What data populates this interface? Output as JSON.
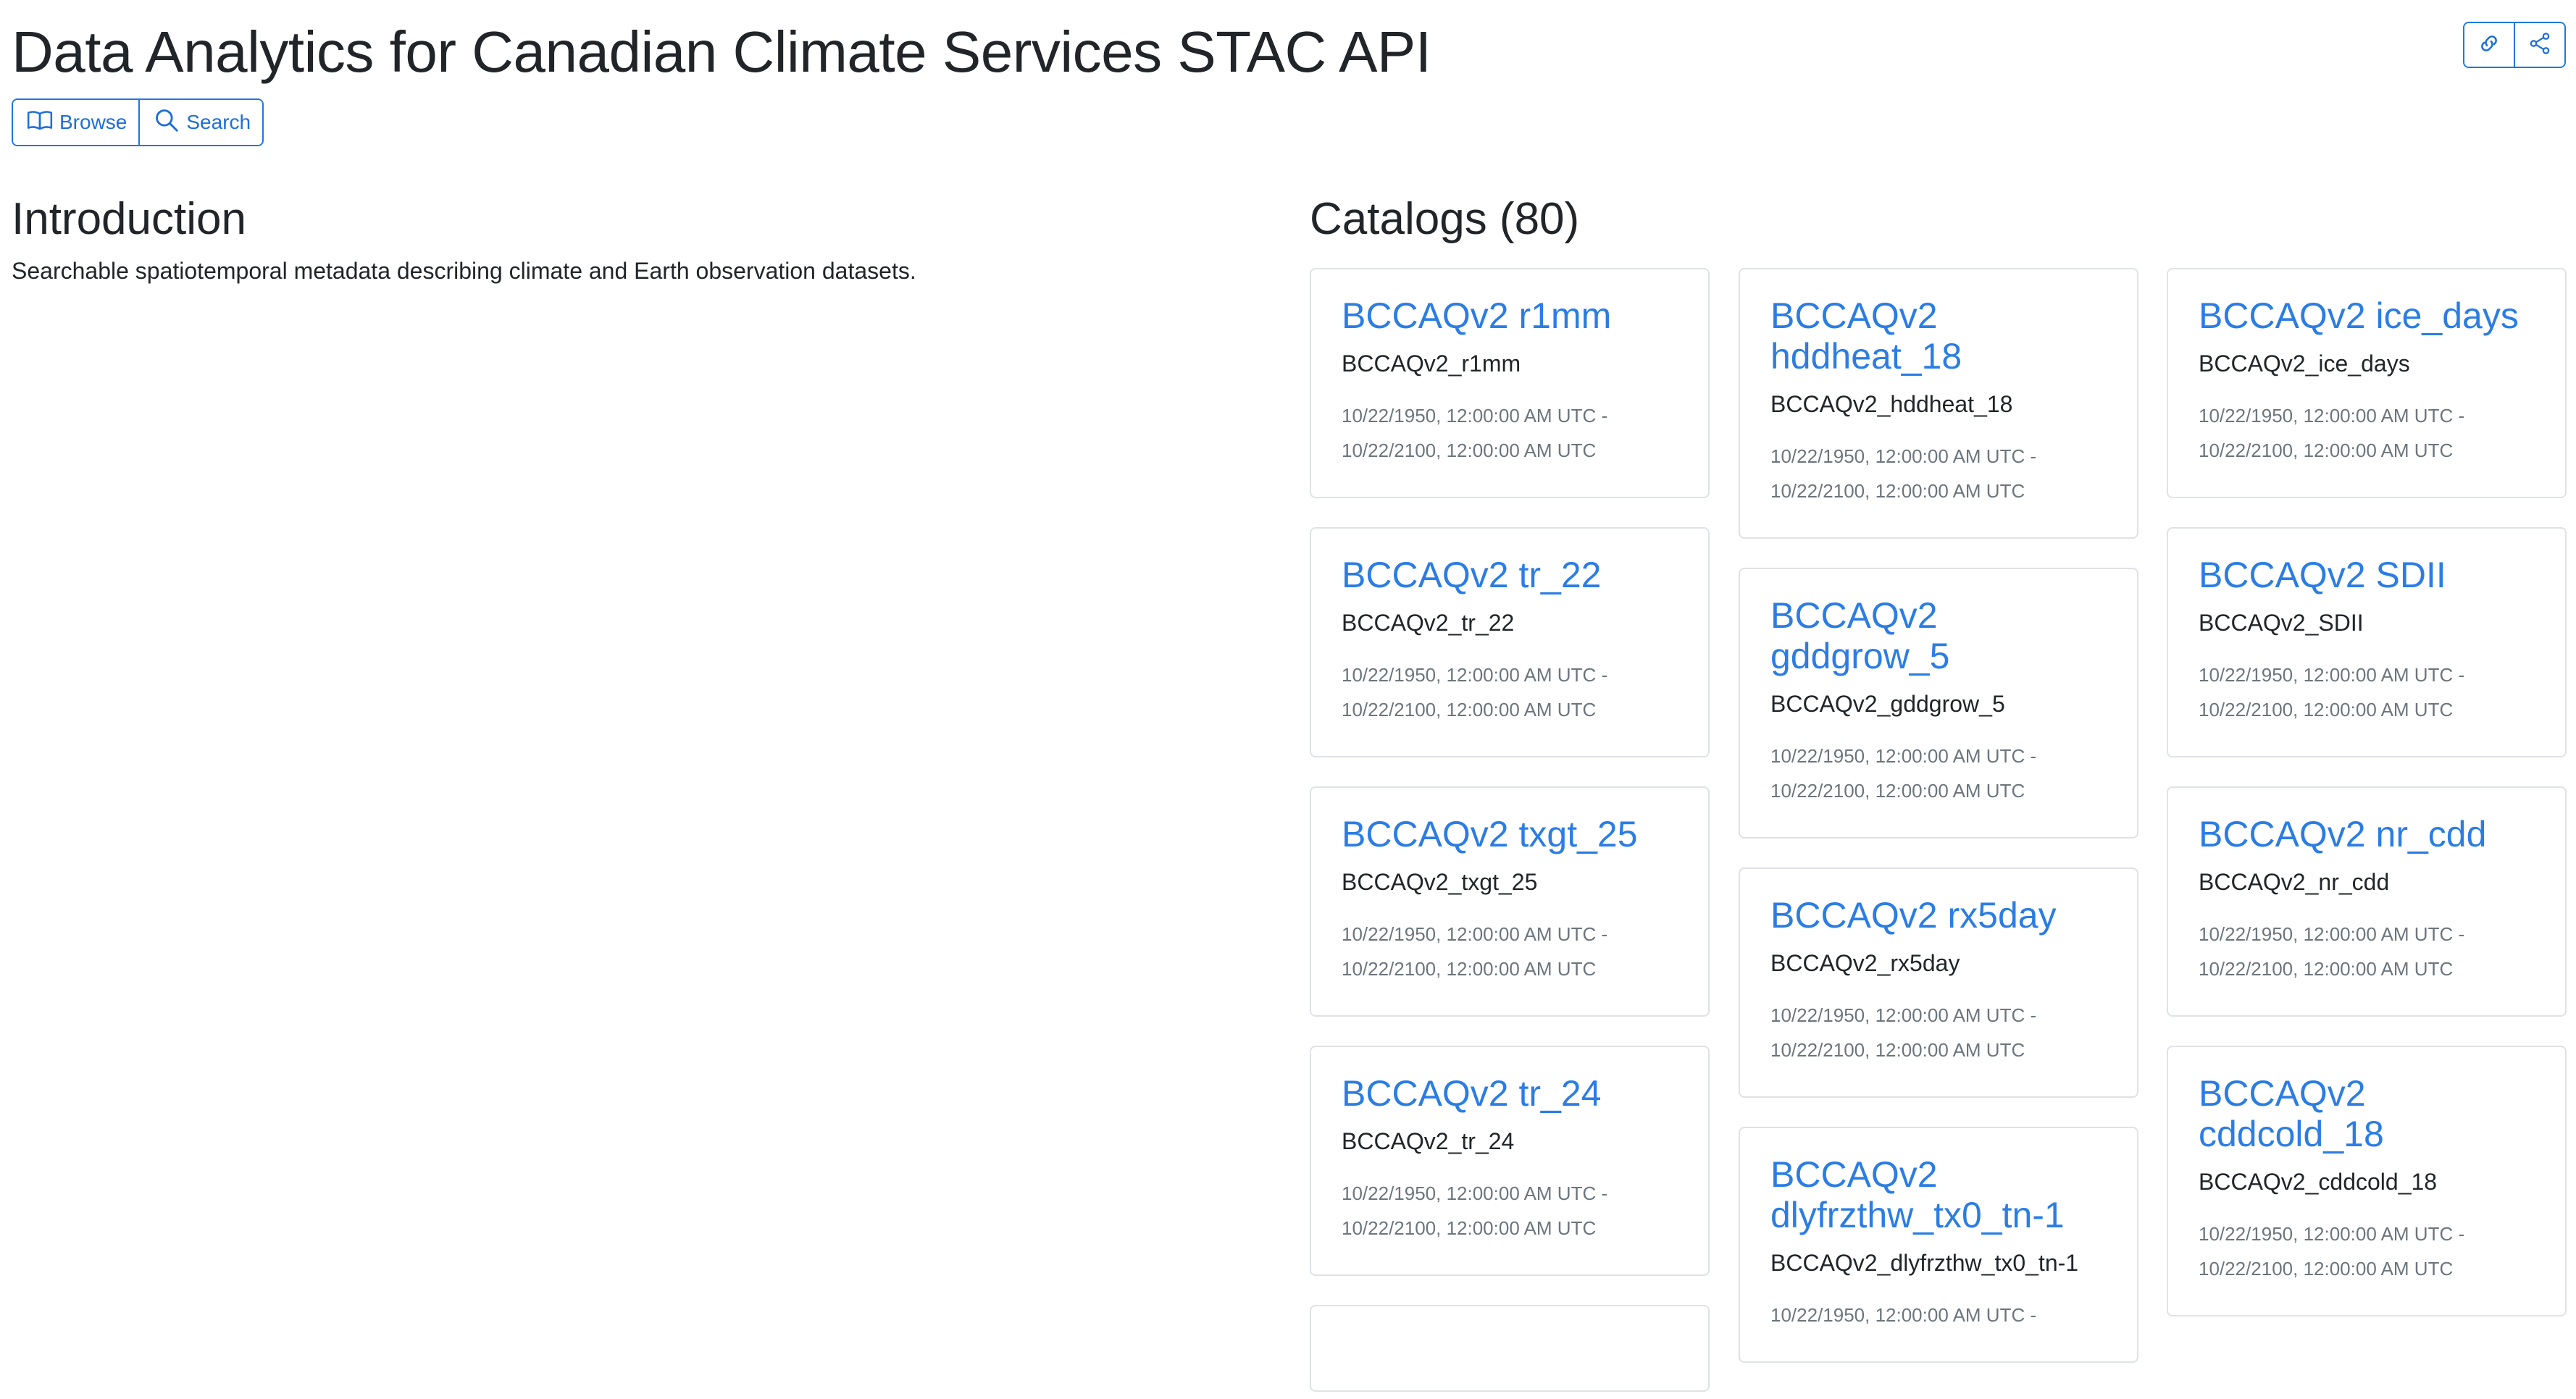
{
  "header": {
    "title": "Data Analytics for Canadian Climate Services STAC API",
    "browse_label": "Browse",
    "search_label": "Search",
    "icons": {
      "browse": "book-icon",
      "search": "search-icon",
      "link": "link-icon",
      "share": "share-icon"
    }
  },
  "intro": {
    "title": "Introduction",
    "description": "Searchable spatiotemporal metadata describing climate and Earth observation datasets."
  },
  "catalogs": {
    "heading": "Catalogs (80)",
    "columns": [
      [
        {
          "title": "BCCAQv2 r1mm",
          "id": "BCCAQv2_r1mm",
          "start": "10/22/1950, 12:00:00 AM UTC -",
          "end": "10/22/2100, 12:00:00 AM UTC"
        },
        {
          "title": "BCCAQv2 tr_22",
          "id": "BCCAQv2_tr_22",
          "start": "10/22/1950, 12:00:00 AM UTC -",
          "end": "10/22/2100, 12:00:00 AM UTC"
        },
        {
          "title": "BCCAQv2 txgt_25",
          "id": "BCCAQv2_txgt_25",
          "start": "10/22/1950, 12:00:00 AM UTC -",
          "end": "10/22/2100, 12:00:00 AM UTC"
        },
        {
          "title": "BCCAQv2 tr_24",
          "id": "BCCAQv2_tr_24",
          "start": "10/22/1950, 12:00:00 AM UTC -",
          "end": "10/22/2100, 12:00:00 AM UTC"
        },
        {
          "title": "",
          "id": "",
          "start": "",
          "end": ""
        }
      ],
      [
        {
          "title": "BCCAQv2 hddheat_18",
          "id": "BCCAQv2_hddheat_18",
          "start": "10/22/1950, 12:00:00 AM UTC -",
          "end": "10/22/2100, 12:00:00 AM UTC"
        },
        {
          "title": "BCCAQv2 gddgrow_5",
          "id": "BCCAQv2_gddgrow_5",
          "start": "10/22/1950, 12:00:00 AM UTC -",
          "end": "10/22/2100, 12:00:00 AM UTC"
        },
        {
          "title": "BCCAQv2 rx5day",
          "id": "BCCAQv2_rx5day",
          "start": "10/22/1950, 12:00:00 AM UTC -",
          "end": "10/22/2100, 12:00:00 AM UTC"
        },
        {
          "title": "BCCAQv2 dlyfrzthw_tx0_tn-1",
          "id": "BCCAQv2_dlyfrzthw_tx0_tn-1",
          "start": "10/22/1950, 12:00:00 AM UTC -",
          "end": ""
        }
      ],
      [
        {
          "title": "BCCAQv2 ice_days",
          "id": "BCCAQv2_ice_days",
          "start": "10/22/1950, 12:00:00 AM UTC -",
          "end": "10/22/2100, 12:00:00 AM UTC"
        },
        {
          "title": "BCCAQv2 SDII",
          "id": "BCCAQv2_SDII",
          "start": "10/22/1950, 12:00:00 AM UTC -",
          "end": "10/22/2100, 12:00:00 AM UTC"
        },
        {
          "title": "BCCAQv2 nr_cdd",
          "id": "BCCAQv2_nr_cdd",
          "start": "10/22/1950, 12:00:00 AM UTC -",
          "end": "10/22/2100, 12:00:00 AM UTC"
        },
        {
          "title": "BCCAQv2 cddcold_18",
          "id": "BCCAQv2_cddcold_18",
          "start": "10/22/1950, 12:00:00 AM UTC -",
          "end": "10/22/2100, 12:00:00 AM UTC"
        }
      ]
    ]
  },
  "colors": {
    "accent": "#2b7de4",
    "button_border": "#1d78e0",
    "card_border": "#dfe2e6",
    "muted_text": "#6c757d"
  }
}
